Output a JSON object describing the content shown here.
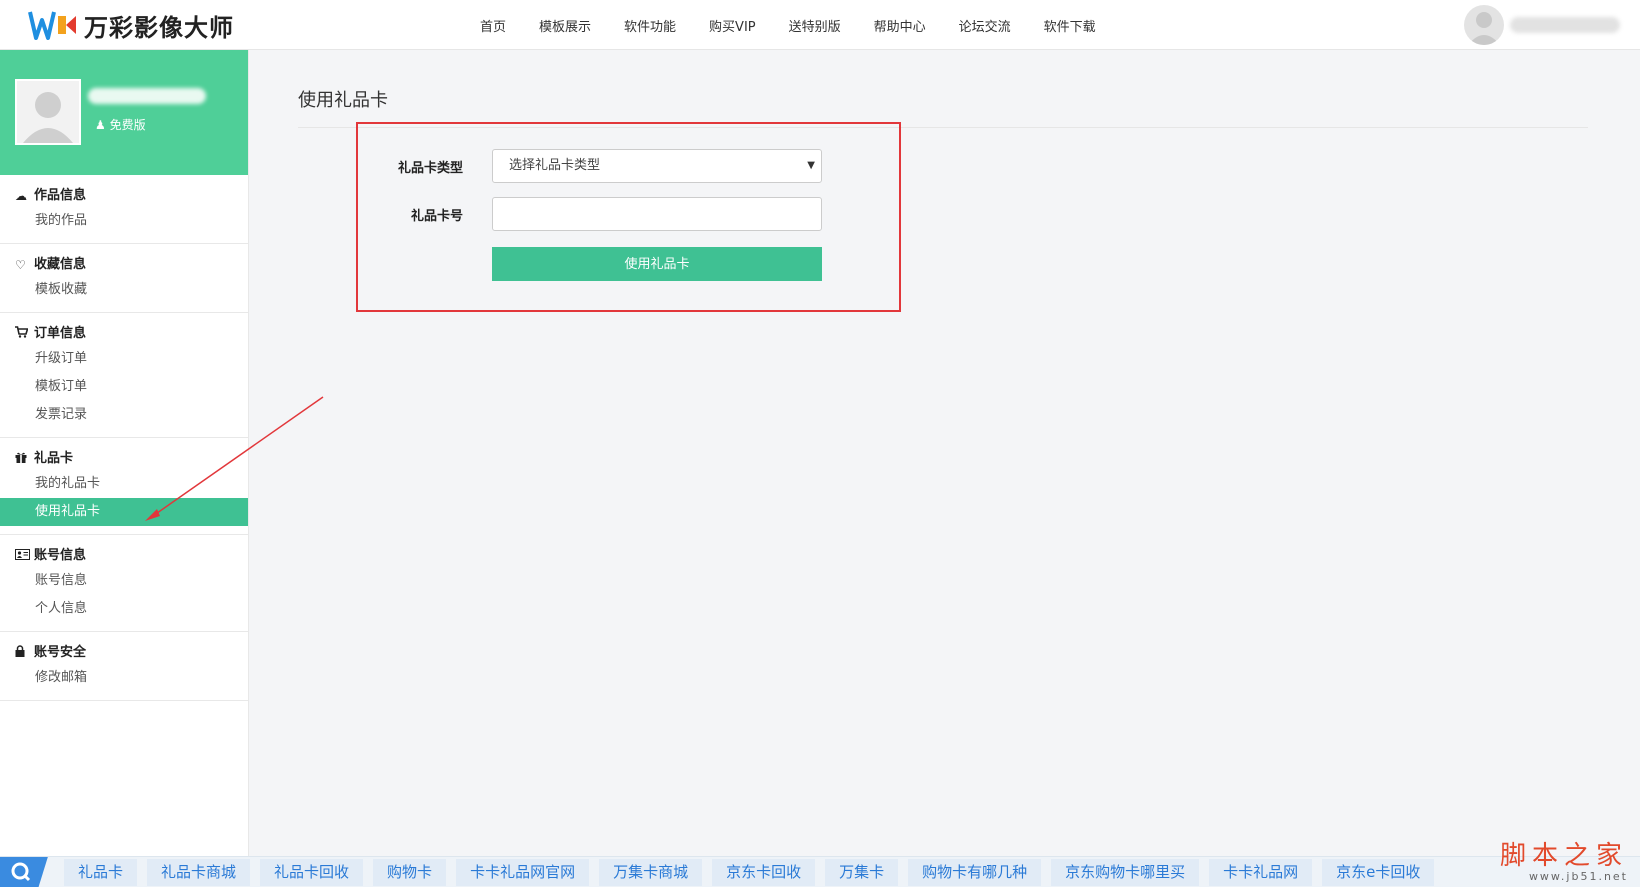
{
  "app": {
    "logo_text": "万彩影像大师"
  },
  "nav": [
    "首页",
    "模板展示",
    "软件功能",
    "购买VIP",
    "送特别版",
    "帮助中心",
    "论坛交流",
    "软件下载"
  ],
  "profile": {
    "version": "免费版"
  },
  "sidebar": {
    "groups": [
      {
        "title": "作品信息",
        "icon": "cloud-upload-icon",
        "items": [
          "我的作品"
        ]
      },
      {
        "title": "收藏信息",
        "icon": "heart-icon",
        "items": [
          "模板收藏"
        ]
      },
      {
        "title": "订单信息",
        "icon": "cart-icon",
        "items": [
          "升级订单",
          "模板订单",
          "发票记录"
        ]
      },
      {
        "title": "礼品卡",
        "icon": "gift-icon",
        "items": [
          "我的礼品卡",
          "使用礼品卡"
        ]
      },
      {
        "title": "账号信息",
        "icon": "id-card-icon",
        "items": [
          "账号信息",
          "个人信息"
        ]
      },
      {
        "title": "账号安全",
        "icon": "lock-icon",
        "items": [
          "修改邮箱"
        ]
      }
    ],
    "active_item": "使用礼品卡"
  },
  "main": {
    "title": "使用礼品卡",
    "form": {
      "type_label": "礼品卡类型",
      "type_placeholder": "选择礼品卡类型",
      "number_label": "礼品卡号",
      "number_value": "",
      "submit_label": "使用礼品卡"
    }
  },
  "bottom_links": [
    "礼品卡",
    "礼品卡商城",
    "礼品卡回收",
    "购物卡",
    "卡卡礼品网官网",
    "万集卡商城",
    "京东卡回收",
    "万集卡",
    "购物卡有哪几种",
    "京东购物卡哪里买",
    "卡卡礼品网",
    "京东e卡回收"
  ],
  "watermark": {
    "title": "脚本之家",
    "url": "www.jb51.net"
  },
  "colors": {
    "accent": "#3fc193",
    "highlight_box": "#e2373b"
  }
}
